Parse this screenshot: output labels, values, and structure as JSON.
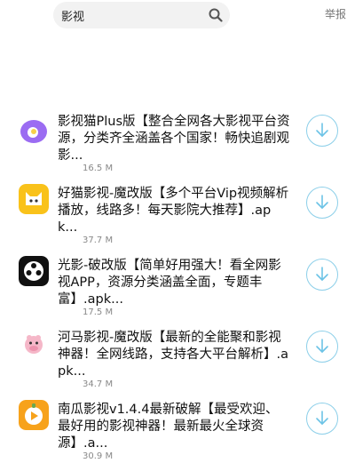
{
  "search": {
    "query": "影视"
  },
  "header": {
    "report_label": "举报"
  },
  "apps": [
    {
      "icon": "purple-circle-app-icon",
      "title": "影视猫Plus版【整合全网各大影视平台资源，分类齐全涵盖各个国家！畅快追剧观影...",
      "size": "16.5 M"
    },
    {
      "icon": "yellow-cat-app-icon",
      "title": "好猫影视-魔改版【多个平台Vip视频解析播放，线路多！每天影院大推荐】.apk...",
      "size": "37.7 M"
    },
    {
      "icon": "black-reel-app-icon",
      "title": "光影-破改版【简单好用强大！看全网影视APP，资源分类涵盖全面，专题丰富】.apk...",
      "size": "17.5 M"
    },
    {
      "icon": "hippo-app-icon",
      "title": "河马影视-魔改版【最新的全能聚和影视神器！全网线路，支持各大平台解析】.apk...",
      "size": "34.7 M"
    },
    {
      "icon": "orange-play-app-icon",
      "title": "南瓜影视v1.4.4最新破解【最受欢迎、最好用的影视神器！最新最火全球资源】.a...",
      "size": "30.9 M"
    }
  ]
}
